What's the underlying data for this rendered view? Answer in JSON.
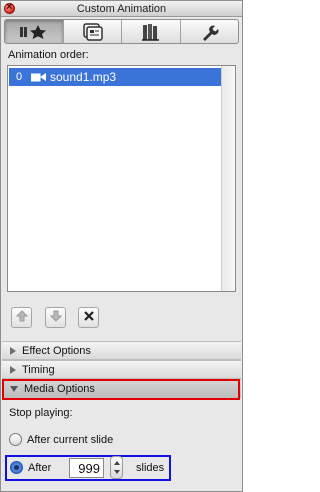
{
  "window": {
    "title": "Custom Animation"
  },
  "tabs": [
    {
      "icon": "star-icon",
      "active": true
    },
    {
      "icon": "slides-icon",
      "active": false
    },
    {
      "icon": "books-icon",
      "active": false
    },
    {
      "icon": "wrench-icon",
      "active": false
    }
  ],
  "animation_order": {
    "label": "Animation order:",
    "items": [
      {
        "index": "0",
        "icon": "sound-icon",
        "name": "sound1.mp3",
        "selected": true
      }
    ]
  },
  "order_buttons": {
    "up": "arrow-up-icon",
    "down": "arrow-down-icon",
    "delete": "delete-x-icon"
  },
  "sections": {
    "effect": "Effect Options",
    "timing": "Timing",
    "media": "Media Options"
  },
  "media_options": {
    "stop_label": "Stop playing:",
    "after_current": "After current slide",
    "after": "After",
    "slides_value": "999",
    "slides": "slides",
    "selected": "after"
  },
  "colors": {
    "selection": "#3b74d9",
    "highlight_red": "#e00000",
    "highlight_blue": "#1010e0"
  }
}
